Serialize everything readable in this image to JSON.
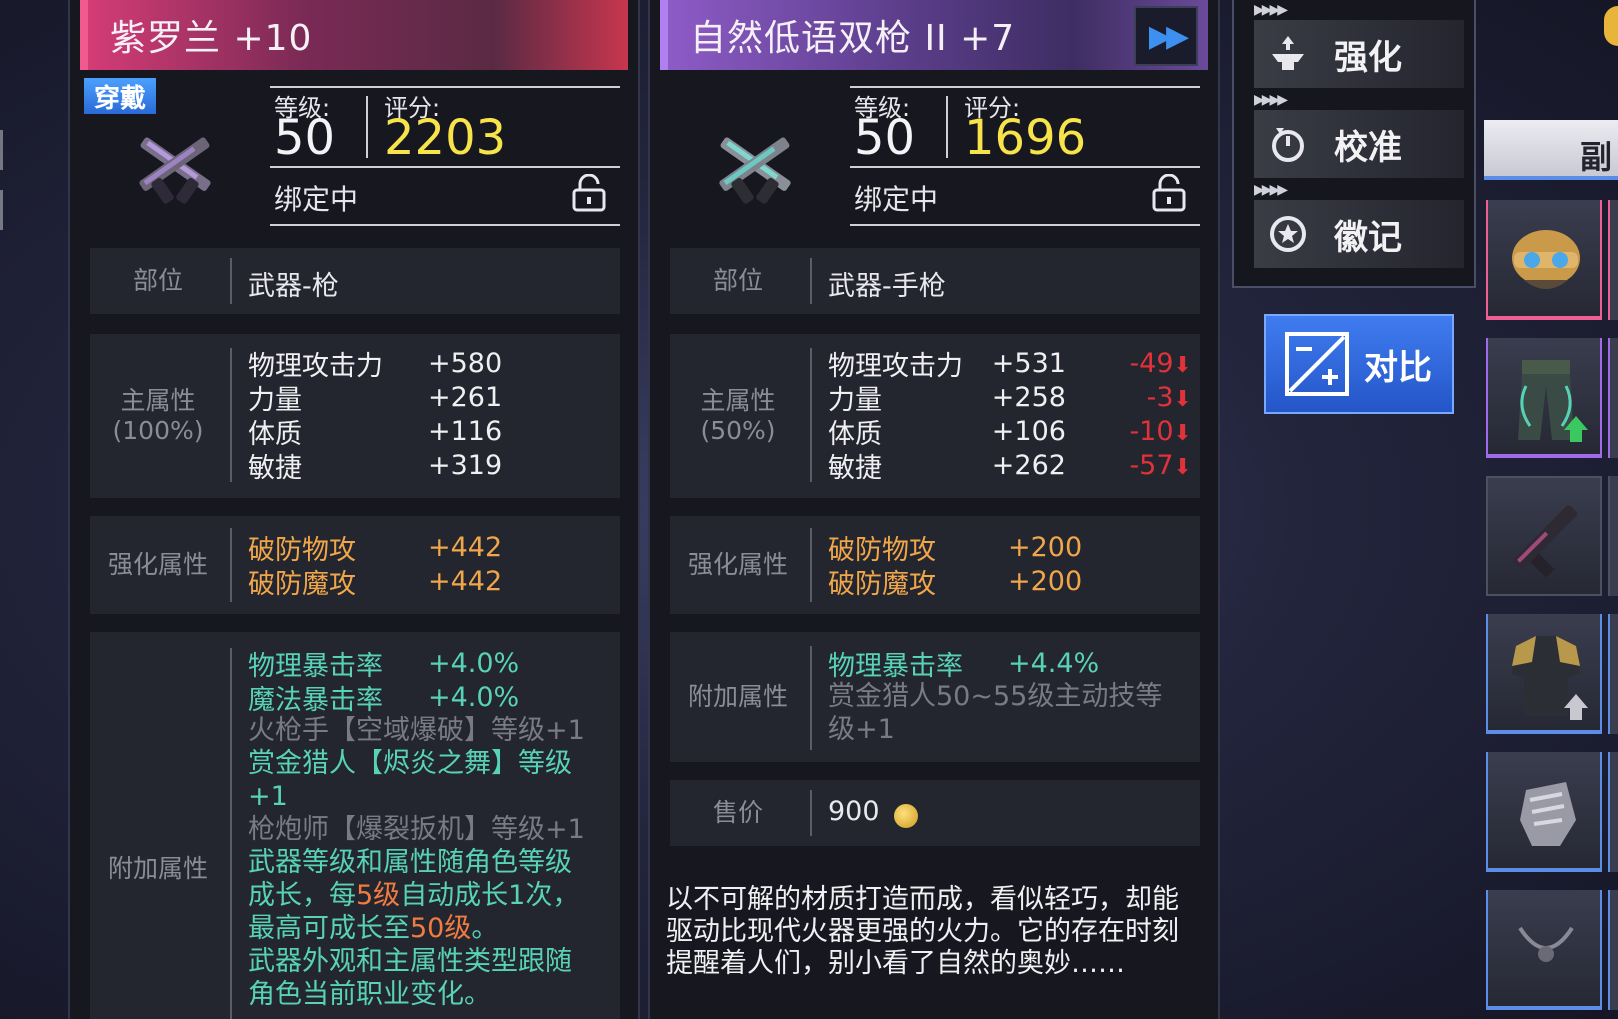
{
  "panel_left": {
    "title": "紫罗兰 +10",
    "badge": "穿戴",
    "level_label": "等级:",
    "level_value": "50",
    "score_label": "评分:",
    "score_value": "2203",
    "bind_status": "绑定中",
    "slot_label": "部位",
    "slot_value": "武器-枪",
    "main_label": "主属性",
    "main_pct": "(100%)",
    "main_stats": [
      {
        "k": "物理攻击力",
        "v": "+580"
      },
      {
        "k": "力量",
        "v": "+261"
      },
      {
        "k": "体质",
        "v": "+116"
      },
      {
        "k": "敏捷",
        "v": "+319"
      }
    ],
    "enh_label": "强化属性",
    "enh_stats": [
      {
        "k": "破防物攻",
        "v": "+442"
      },
      {
        "k": "破防魔攻",
        "v": "+442"
      }
    ],
    "extra_label": "附加属性",
    "extra_stats": [
      {
        "k": "物理暴击率",
        "v": "+4.0%"
      },
      {
        "k": "魔法暴击率",
        "v": "+4.0%"
      }
    ],
    "extra_lines": {
      "l1": "火枪手【空域爆破】等级+1",
      "l2": "赏金猎人【烬炎之舞】等级",
      "l3": "+1",
      "l4": "枪炮师【爆裂扳机】等级+1",
      "l5": "武器等级和属性随角色等级",
      "l6a": "成长，每",
      "l6b": "5级",
      "l6c": "自动成长1次，",
      "l7a": "最高可成长至",
      "l7b": "50级",
      "l7c": "。",
      "l8": "武器外观和主属性类型跟随",
      "l9": "角色当前职业变化。"
    }
  },
  "panel_right": {
    "title": "自然低语双枪 II +7",
    "level_label": "等级:",
    "level_value": "50",
    "score_label": "评分:",
    "score_value": "1696",
    "bind_status": "绑定中",
    "slot_label": "部位",
    "slot_value": "武器-手枪",
    "main_label": "主属性",
    "main_pct": "(50%)",
    "main_stats": [
      {
        "k": "物理攻击力",
        "v": "+531",
        "d": "-49"
      },
      {
        "k": "力量",
        "v": "+258",
        "d": "-3"
      },
      {
        "k": "体质",
        "v": "+106",
        "d": "-10"
      },
      {
        "k": "敏捷",
        "v": "+262",
        "d": "-57"
      }
    ],
    "enh_label": "强化属性",
    "enh_stats": [
      {
        "k": "破防物攻",
        "v": "+200"
      },
      {
        "k": "破防魔攻",
        "v": "+200"
      }
    ],
    "extra_label": "附加属性",
    "extra_stat": {
      "k": "物理暴击率",
      "v": "+4.4%"
    },
    "extra_gray_1": "赏金猎人50~55级主动技等",
    "extra_gray_2": "级+1",
    "price_label": "售价",
    "price_value": "900",
    "description": "以不可解的材质打造而成，看似轻巧，却能驱动比现代火器更强的火力。它的存在时刻提醒着人们，别小看了自然的奥妙……"
  },
  "menu": {
    "enhance": "强化",
    "calibrate": "校准",
    "emblem": "徽记",
    "compare": "对比"
  },
  "side_tab": "副",
  "colors": {
    "score": "#f7e34a",
    "decrease": "#e0323a",
    "enhance_orange": "#f0a64a",
    "extra_teal": "#58d2b6",
    "compare_blue": "#3f7cf0"
  }
}
